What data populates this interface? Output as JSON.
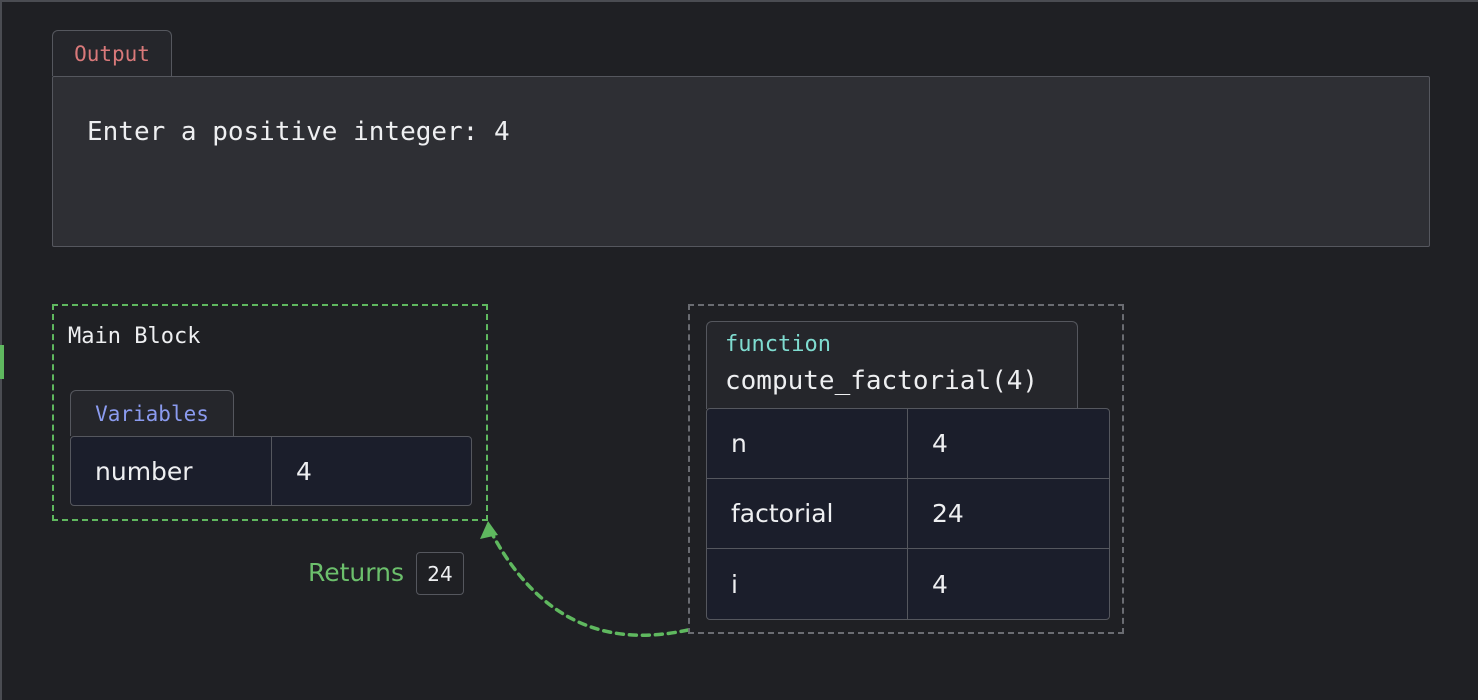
{
  "output": {
    "tab_label": "Output",
    "text": "Enter a positive integer: 4"
  },
  "main_block": {
    "title": "Main Block",
    "variables_tab": "Variables",
    "variables": [
      {
        "name": "number",
        "value": "4"
      }
    ]
  },
  "function_frame": {
    "kind": "function",
    "signature": "compute_factorial(4)",
    "variables": [
      {
        "name": "n",
        "value": "4"
      },
      {
        "name": "factorial",
        "value": "24"
      },
      {
        "name": "i",
        "value": "4"
      }
    ]
  },
  "return_info": {
    "label": "Returns",
    "value": "24"
  },
  "colors": {
    "background": "#1f2024",
    "main_block_border": "#5fb85f",
    "output_tab_text": "#d9797a",
    "variables_tab_text": "#8b9bef",
    "function_kind_text": "#7fdcd0",
    "returns_text": "#6cc06c"
  }
}
